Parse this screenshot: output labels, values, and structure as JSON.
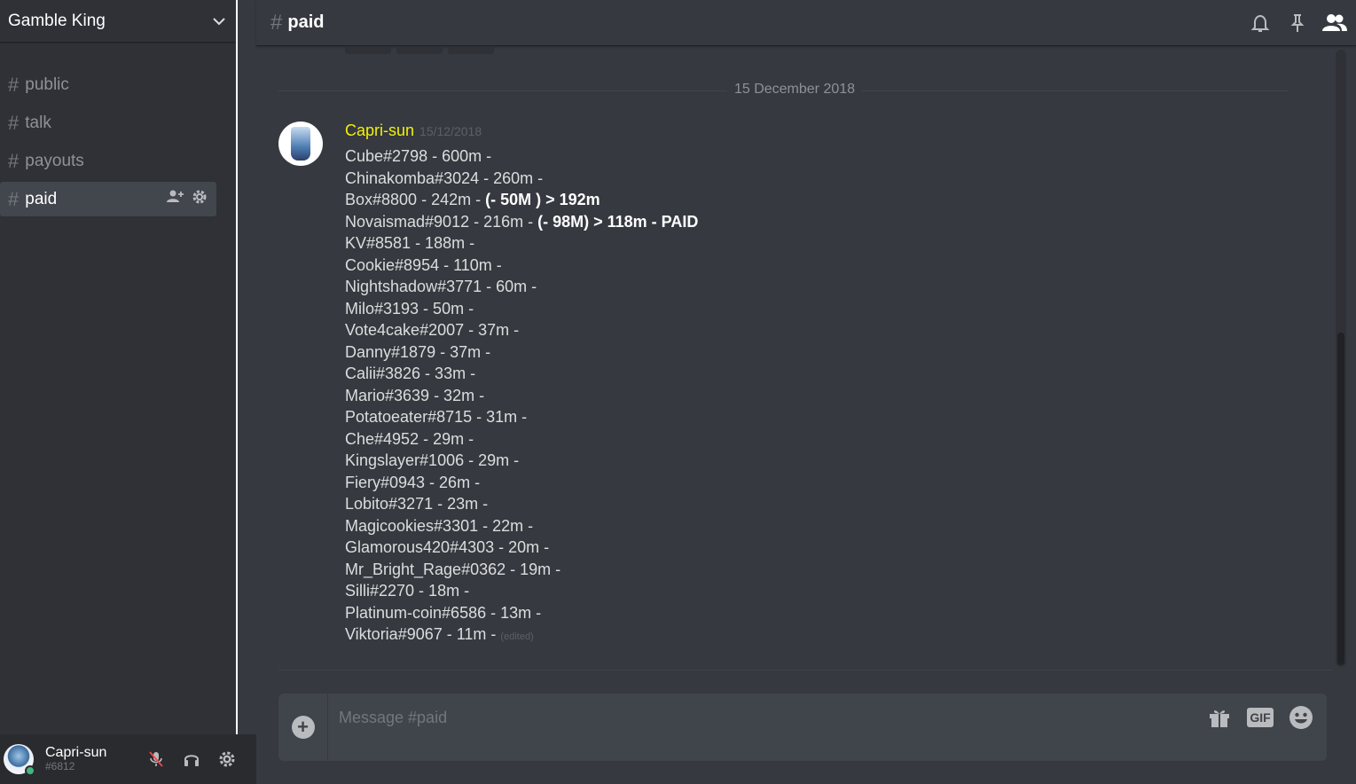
{
  "guild": {
    "name": "Gamble King"
  },
  "channels": [
    {
      "name": "public"
    },
    {
      "name": "talk"
    },
    {
      "name": "payouts"
    },
    {
      "name": "paid"
    }
  ],
  "header": {
    "channel_name": "paid"
  },
  "divider": {
    "date": "15 December 2018"
  },
  "message": {
    "author": "Capri-sun",
    "author_color": "#f1f10a",
    "timestamp": "15/12/2018",
    "edited_label": "(edited)",
    "lines": [
      {
        "text": "Cube#2798 - 600m -",
        "bold": ""
      },
      {
        "text": "Chinakomba#3024 - 260m -",
        "bold": ""
      },
      {
        "text": "Box#8800 - 242m - ",
        "bold": "(- 50M ) > 192m"
      },
      {
        "text": "Novaismad#9012 - 216m -  ",
        "bold": "(- 98M) > 118m - PAID"
      },
      {
        "text": "KV#8581 - 188m -",
        "bold": ""
      },
      {
        "text": "Cookie#8954 - 110m -",
        "bold": ""
      },
      {
        "text": "Nightshadow#3771 - 60m -",
        "bold": ""
      },
      {
        "text": "Milo#3193 - 50m -",
        "bold": ""
      },
      {
        "text": "Vote4cake#2007 - 37m -",
        "bold": ""
      },
      {
        "text": "Danny#1879 - 37m -",
        "bold": ""
      },
      {
        "text": "Calii#3826 - 33m -",
        "bold": ""
      },
      {
        "text": "Mario#3639 - 32m -",
        "bold": ""
      },
      {
        "text": "Potatoeater#8715 - 31m -",
        "bold": ""
      },
      {
        "text": "Che#4952 - 29m -",
        "bold": ""
      },
      {
        "text": "Kingslayer#1006 - 29m -",
        "bold": ""
      },
      {
        "text": "Fiery#0943 - 26m -",
        "bold": ""
      },
      {
        "text": "Lobito#3271 - 23m -",
        "bold": ""
      },
      {
        "text": "Magicookies#3301 - 22m -",
        "bold": ""
      },
      {
        "text": "Glamorous420#4303 - 20m -",
        "bold": ""
      },
      {
        "text": "Mr_Bright_Rage#0362 - 19m -",
        "bold": ""
      },
      {
        "text": "Silli#2270 - 18m -",
        "bold": ""
      },
      {
        "text": "Platinum-coin#6586 - 13m -",
        "bold": ""
      },
      {
        "text": "Viktoria#9067 - 11m - ",
        "bold": ""
      }
    ]
  },
  "composer": {
    "placeholder": "Message #paid",
    "gif_label": "GIF"
  },
  "user": {
    "name": "Capri-sun",
    "tag": "#6812",
    "status_color": "#43b581"
  }
}
